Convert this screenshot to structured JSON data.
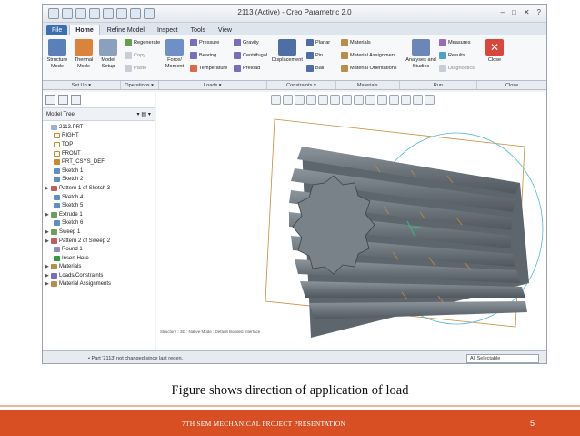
{
  "window": {
    "title": "2113 (Active) - Creo Parametric 2.0"
  },
  "tabs": [
    "File",
    "Home",
    "Refine Model",
    "Inspect",
    "Tools",
    "View"
  ],
  "ribbon": {
    "structure_mode": "Structure Mode",
    "thermal_mode": "Thermal Mode",
    "model_setup": "Model Setup",
    "regenerate": "Regenerate",
    "copy": "Copy",
    "paste": "Paste",
    "force_moment": "Force/ Moment",
    "pressure": "Pressure",
    "bearing": "Bearing",
    "temperature": "Temperature",
    "gravity": "Gravity",
    "centrifugal": "Centrifugal",
    "preload": "Preload",
    "displacement": "Displacement",
    "planar": "Planar",
    "pin": "Pin",
    "ball": "Ball",
    "materials": "Materials",
    "material_assignment": "Material Assignment",
    "material_orientations": "Material Orientations",
    "analyses": "Analyses and Studies",
    "measures": "Measures",
    "results": "Results",
    "diagnostics": "Diagnostics",
    "close": "Close"
  },
  "groups": [
    "Set Up ▾",
    "Operations ▾",
    "Loads ▾",
    "Constraints ▾",
    "Materials",
    "Run",
    "Close"
  ],
  "model_tree": {
    "title": "Model Tree",
    "items": [
      "2113.PRT",
      "RIGHT",
      "TOP",
      "FRONT",
      "PRT_CSYS_DEF",
      "Sketch 1",
      "Sketch 2",
      "Pattern 1 of Sketch 3",
      "Sketch 4",
      "Sketch 5",
      "Extrude 1",
      "Sketch 6",
      "Sweep 1",
      "Pattern 2 of Sweep 2",
      "Round 1",
      "Insert Here",
      "Materials",
      "Loads/Constraints",
      "Material Assignments"
    ]
  },
  "viewport": {
    "status": "Structure : 3D : Native Mode : Default Bonded Interface"
  },
  "statusbar": {
    "message": "• Part '2113' not changed since last regen.",
    "filter": "All Selectable"
  },
  "slide": {
    "caption": "Figure shows direction of application of load",
    "footer": "7TH SEM MECHANICAL PROJECT PRESENTATION",
    "page": "5"
  },
  "colors": {
    "accent": "#d84f23",
    "model": "#6e7780",
    "highlight": "#c88b3a"
  }
}
